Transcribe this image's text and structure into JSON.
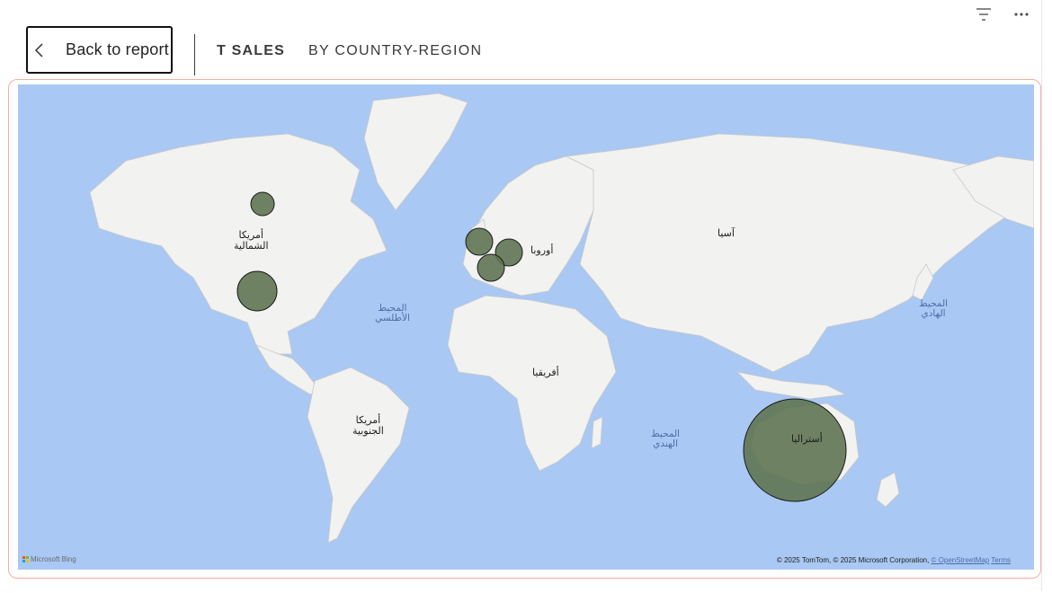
{
  "header": {
    "back_label": "Back to report",
    "title": "T SALES",
    "subtitle": "BY COUNTRY-REGION"
  },
  "toolbar": {
    "icons": [
      "filter-icon",
      "more-options-icon"
    ]
  },
  "map": {
    "continent_labels": {
      "north_america": [
        "أمريكا",
        "الشمالية"
      ],
      "south_america": [
        "أمريكا",
        "الجنوبية"
      ],
      "europe": "أوروبا",
      "africa": "أفريقيا",
      "asia": "آسيا",
      "australia": "أستراليا"
    },
    "ocean_labels": {
      "atlantic": [
        "المحيط",
        "الأطلسي"
      ],
      "indian": [
        "المحيط",
        "الهندي"
      ],
      "pacific": [
        "المحيط",
        "الهادي"
      ]
    },
    "provider_logo": "Microsoft Bing",
    "attribution_text": "© 2025 TomTom, © 2025 Microsoft Corporation, ",
    "attribution_link": "© OpenStreetMap",
    "attribution_terms": "Terms",
    "bubble_color": "#5f7452"
  },
  "chart_data": {
    "type": "bubble-map",
    "points": [
      {
        "lat": 53,
        "lon": -94
      },
      {
        "lat": 38,
        "lon": -99
      },
      {
        "lat": 54,
        "lon": -3
      },
      {
        "lat": 51,
        "lon": 10
      },
      {
        "lat": 46,
        "lon": 2
      },
      {
        "lat": -25,
        "lon": 134
      }
    ]
  }
}
